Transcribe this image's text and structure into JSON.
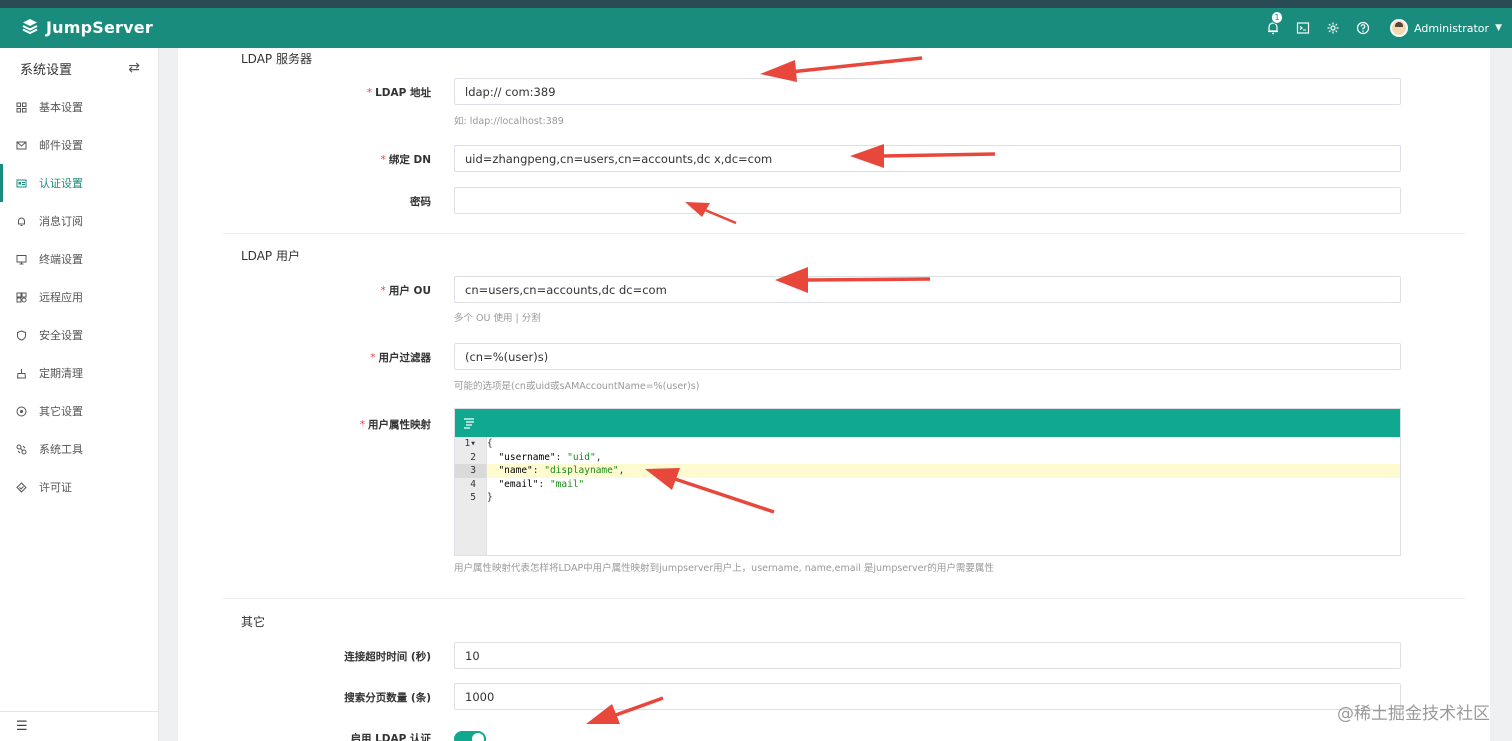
{
  "header": {
    "brand": "JumpServer",
    "notification_count": "1",
    "user_name": "Administrator",
    "accent_color": "#1a8c7d",
    "icons": [
      "bell-icon",
      "terminal-icon",
      "gear-icon",
      "help-icon",
      "chevron-down-icon"
    ]
  },
  "sidebar": {
    "title": "系统设置",
    "items": [
      {
        "label": "基本设置",
        "icon": "grid-icon"
      },
      {
        "label": "邮件设置",
        "icon": "mail-icon"
      },
      {
        "label": "认证设置",
        "icon": "id-card-icon",
        "active": true
      },
      {
        "label": "消息订阅",
        "icon": "bell-icon"
      },
      {
        "label": "终端设置",
        "icon": "monitor-icon"
      },
      {
        "label": "远程应用",
        "icon": "apps-icon"
      },
      {
        "label": "安全设置",
        "icon": "shield-icon"
      },
      {
        "label": "定期清理",
        "icon": "broom-icon"
      },
      {
        "label": "其它设置",
        "icon": "circle-icon"
      },
      {
        "label": "系统工具",
        "icon": "tools-icon"
      },
      {
        "label": "许可证",
        "icon": "license-icon"
      }
    ]
  },
  "form": {
    "ldap_server_title": "LDAP 服务器",
    "ldap_address_label": "LDAP 地址",
    "ldap_address_value": "ldap://              com:389",
    "ldap_address_hint": "如: ldap://localhost:389",
    "bind_dn_label": "绑定 DN",
    "bind_dn_value": "uid=zhangpeng,cn=users,cn=accounts,dc         x,dc=com",
    "password_label": "密码",
    "password_value": "",
    "ldap_user_title": "LDAP 用户",
    "user_ou_label": "用户 OU",
    "user_ou_value": "cn=users,cn=accounts,dc           dc=com",
    "user_ou_hint": "多个 OU 使用 | 分割",
    "user_filter_label": "用户过滤器",
    "user_filter_value": "(cn=%(user)s)",
    "user_filter_hint": "可能的选项是(cn或uid或sAMAccountName=%(user)s)",
    "attr_map_label": "用户属性映射",
    "attr_map_lines": [
      "{",
      "  \"username\": \"uid\",",
      "  \"name\": \"displayname\",",
      "  \"email\": \"mail\"",
      "}"
    ],
    "attr_map_hint": "用户属性映射代表怎样将LDAP中用户属性映射到jumpserver用户上，username, name,email 是jumpserver的用户需要属性",
    "other_title": "其它",
    "timeout_label": "连接超时时间 (秒)",
    "timeout_value": "10",
    "page_size_label": "搜索分页数量 (条)",
    "page_size_value": "1000",
    "enable_ldap_label": "启用 LDAP 认证",
    "enable_ldap_on": true
  },
  "watermark": "@稀土掘金技术社区"
}
